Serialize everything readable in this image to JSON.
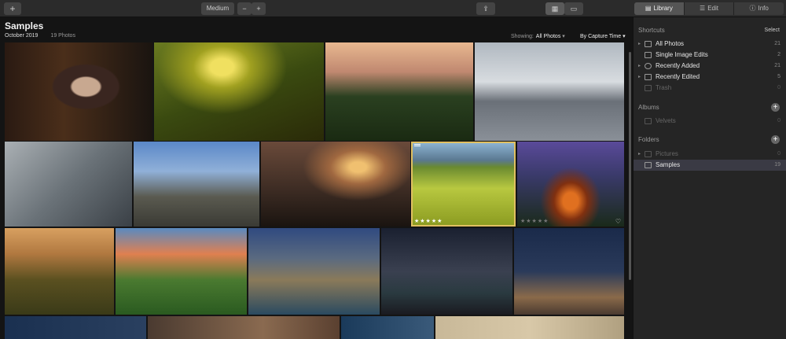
{
  "toolbar": {
    "add_label": "+",
    "size_label": "Medium",
    "zoom_out_label": "−",
    "zoom_in_label": "+",
    "share_label": "⇪",
    "view_grid_label": "▦",
    "view_single_label": "▭"
  },
  "tabs": [
    {
      "label": "Library",
      "icon": "▤"
    },
    {
      "label": "Edit",
      "icon": "☰"
    },
    {
      "label": "Info",
      "icon": "ⓘ"
    }
  ],
  "main": {
    "title": "Samples",
    "date": "October 2019",
    "count": "19 Photos",
    "showing_label": "Showing:",
    "showing_value": "All Photos",
    "sort_label": "By Capture Time"
  },
  "photo_badges": {
    "stars": "★★★★★",
    "heart": "♡"
  },
  "sidebar": {
    "shortcuts": {
      "title": "Shortcuts",
      "action": "Select",
      "items": [
        {
          "label": "All Photos",
          "count": "21"
        },
        {
          "label": "Single Image Edits",
          "count": "2"
        },
        {
          "label": "Recently Added",
          "count": "21"
        },
        {
          "label": "Recently Edited",
          "count": "5"
        },
        {
          "label": "Trash",
          "count": "0"
        }
      ]
    },
    "albums": {
      "title": "Albums",
      "items": [
        {
          "label": "Velvets",
          "count": "0"
        }
      ]
    },
    "folders": {
      "title": "Folders",
      "items": [
        {
          "label": "Pictures",
          "count": "0"
        },
        {
          "label": "Samples",
          "count": "19"
        }
      ]
    }
  },
  "colors": {
    "accent": "#e0c060",
    "selection": "#3a3a44",
    "background": "#141414"
  }
}
